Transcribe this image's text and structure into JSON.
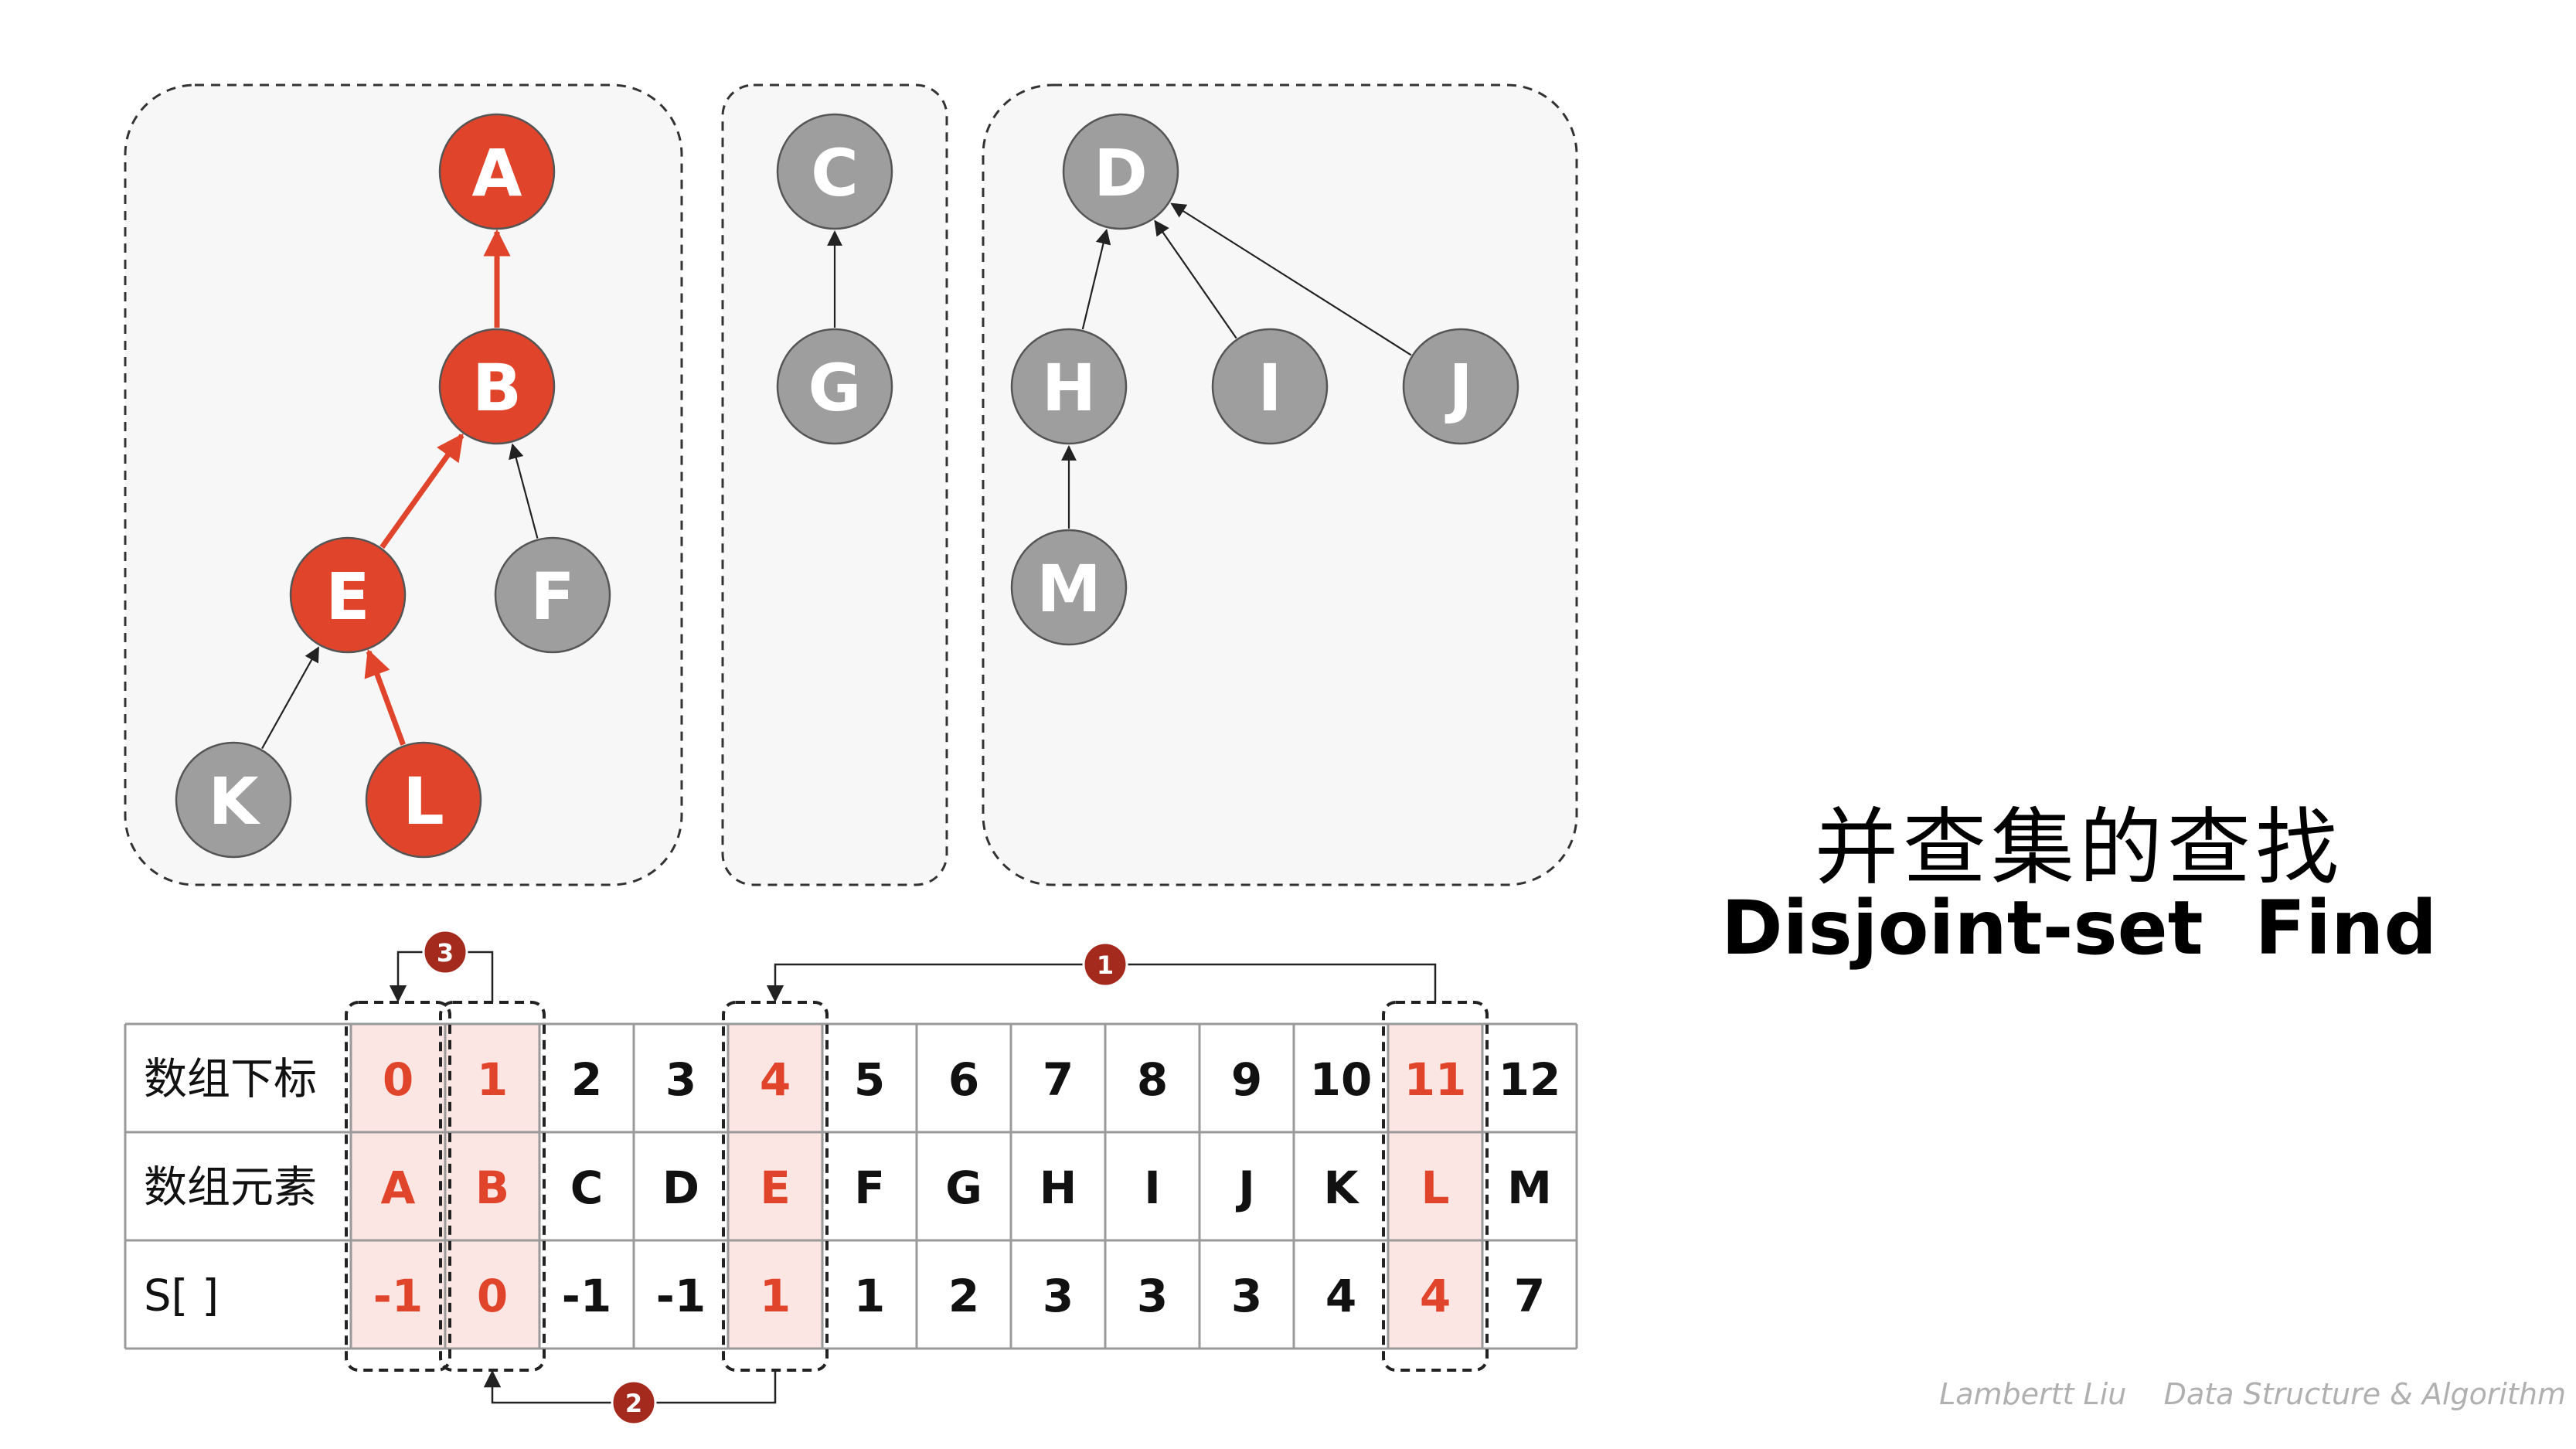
{
  "title": {
    "zh": "并查集的查找",
    "en": "Disjoint-set  Find"
  },
  "credit": "Lambertt Liu    Data Structure & Algorithm",
  "colors": {
    "highlight": "#E0442B",
    "node_gray": "#9E9E9E",
    "node_stroke": "#555555",
    "group_bg": "#F7F7F7",
    "cell_highlight_bg": "#FBE6E3",
    "badge": "#A52A1E",
    "text_dark": "#111111"
  },
  "trees": {
    "nodes": [
      {
        "id": "A",
        "highlighted": true
      },
      {
        "id": "B",
        "highlighted": true
      },
      {
        "id": "E",
        "highlighted": true
      },
      {
        "id": "F",
        "highlighted": false
      },
      {
        "id": "K",
        "highlighted": false
      },
      {
        "id": "L",
        "highlighted": true
      },
      {
        "id": "C",
        "highlighted": false
      },
      {
        "id": "G",
        "highlighted": false
      },
      {
        "id": "D",
        "highlighted": false
      },
      {
        "id": "H",
        "highlighted": false
      },
      {
        "id": "I",
        "highlighted": false
      },
      {
        "id": "J",
        "highlighted": false
      },
      {
        "id": "M",
        "highlighted": false
      }
    ],
    "edges": [
      {
        "from": "B",
        "to": "A",
        "highlighted": true
      },
      {
        "from": "E",
        "to": "B",
        "highlighted": true
      },
      {
        "from": "F",
        "to": "B",
        "highlighted": false
      },
      {
        "from": "K",
        "to": "E",
        "highlighted": false
      },
      {
        "from": "L",
        "to": "E",
        "highlighted": true
      },
      {
        "from": "G",
        "to": "C",
        "highlighted": false
      },
      {
        "from": "H",
        "to": "D",
        "highlighted": false
      },
      {
        "from": "I",
        "to": "D",
        "highlighted": false
      },
      {
        "from": "J",
        "to": "D",
        "highlighted": false
      },
      {
        "from": "M",
        "to": "H",
        "highlighted": false
      }
    ]
  },
  "table": {
    "row_headers": [
      "数组下标",
      "数组元素",
      "S[ ]"
    ],
    "indices": [
      "0",
      "1",
      "2",
      "3",
      "4",
      "5",
      "6",
      "7",
      "8",
      "9",
      "10",
      "11",
      "12"
    ],
    "elements": [
      "A",
      "B",
      "C",
      "D",
      "E",
      "F",
      "G",
      "H",
      "I",
      "J",
      "K",
      "L",
      "M"
    ],
    "parents": [
      "-1",
      "0",
      "-1",
      "-1",
      "1",
      "1",
      "2",
      "3",
      "3",
      "3",
      "4",
      "4",
      "7"
    ],
    "highlighted_columns": [
      0,
      1,
      4,
      11
    ]
  },
  "steps": [
    {
      "badge": "1",
      "from_index": 11,
      "to_index": 4
    },
    {
      "badge": "2",
      "from_index": 4,
      "to_index": 1
    },
    {
      "badge": "3",
      "from_index": 1,
      "to_index": 0
    }
  ]
}
